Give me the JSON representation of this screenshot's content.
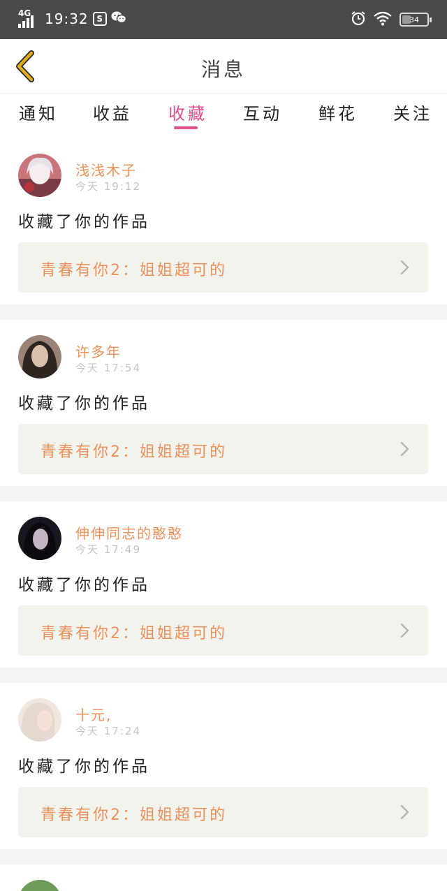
{
  "status_bar": {
    "network": "4G",
    "time": "19:32",
    "app_icon_letter": "S",
    "battery": "34"
  },
  "header": {
    "title": "消息"
  },
  "tabs": [
    {
      "label": "通知",
      "active": false
    },
    {
      "label": "收益",
      "active": false
    },
    {
      "label": "收藏",
      "active": true
    },
    {
      "label": "互动",
      "active": false
    },
    {
      "label": "鲜花",
      "active": false
    },
    {
      "label": "关注",
      "active": false
    }
  ],
  "feed": [
    {
      "user": "浅浅木子",
      "time": "今天 19:12",
      "action": "收藏了你的作品",
      "work": "青春有你2：姐姐超可的"
    },
    {
      "user": "许多年",
      "time": "今天 17:54",
      "action": "收藏了你的作品",
      "work": "青春有你2：姐姐超可的"
    },
    {
      "user": "伸伸同志的憨憨",
      "time": "今天 17:49",
      "action": "收藏了你的作品",
      "work": "青春有你2：姐姐超可的"
    },
    {
      "user": "十元,",
      "time": "今天 17:24",
      "action": "收藏了你的作品",
      "work": "青春有你2：姐姐超可的"
    }
  ],
  "colors": {
    "accent_pink": "#e04e8e",
    "name_orange": "#ec915a",
    "back_arrow_gold": "#d8a21a",
    "status_bar_bg": "#4a4a4a"
  }
}
